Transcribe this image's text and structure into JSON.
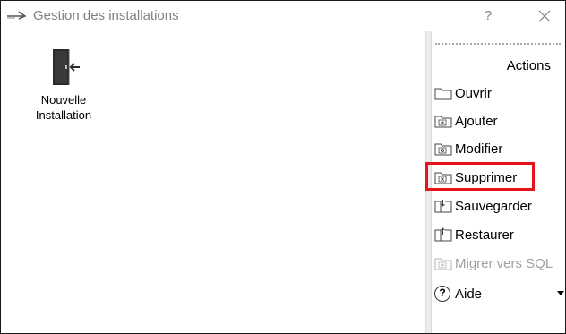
{
  "window": {
    "title": "Gestion des installations",
    "help_label": "?",
    "close_label": "✕"
  },
  "desktop": {
    "items": [
      {
        "label_line1": "Nouvelle",
        "label_line2": "Installation",
        "icon": "door-enter-icon"
      }
    ]
  },
  "actions": {
    "header": "Actions",
    "items": [
      {
        "label": "Ouvrir",
        "icon": "folder-open-icon",
        "enabled": true
      },
      {
        "label": "Ajouter",
        "icon": "folder-add-icon",
        "enabled": true
      },
      {
        "label": "Modifier",
        "icon": "folder-edit-icon",
        "enabled": true
      },
      {
        "label": "Supprimer",
        "icon": "folder-delete-icon",
        "enabled": true,
        "highlighted": true
      },
      {
        "label": "Sauvegarder",
        "icon": "folder-save-icon",
        "enabled": true
      },
      {
        "label": "Restaurer",
        "icon": "folder-restore-icon",
        "enabled": true
      },
      {
        "label": "Migrer vers SQL",
        "icon": "folder-migrate-icon",
        "enabled": false
      },
      {
        "label": "Aide",
        "icon": "help-icon",
        "enabled": true,
        "has_dropdown": true
      }
    ]
  },
  "colors": {
    "highlight": "#e8141b",
    "disabled_text": "#a0a0a0",
    "title_text": "#808080"
  }
}
